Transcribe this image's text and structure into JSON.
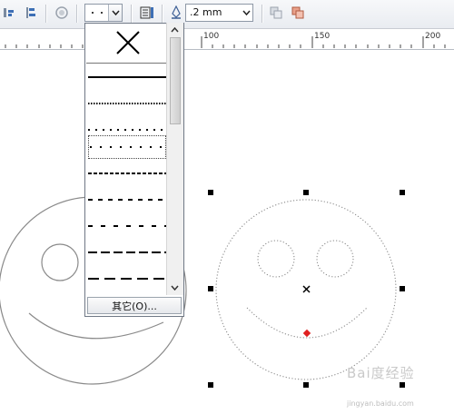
{
  "toolbar": {
    "outline_width_value": ".2 mm",
    "line_style_current": "dotted",
    "icons": [
      "align-icon",
      "distribute-icon",
      "contour-icon",
      "line-style-icon",
      "outline-pen-icon",
      "to-front-icon",
      "to-back-icon"
    ]
  },
  "ruler": {
    "labels": [
      "100",
      "150",
      "200"
    ]
  },
  "dropdown": {
    "options": [
      "none",
      "solid",
      "fine-dotted",
      "dotted",
      "dotted-wide",
      "short-dash",
      "dash",
      "medium-dash",
      "long-dash",
      "extra-long-dash"
    ],
    "selected_index": 3,
    "other_button_label": "其它(O)..."
  },
  "canvas": {
    "selection_marker_color": "#e02020"
  },
  "watermark": {
    "logo_text": "Bai度经验",
    "url": "jingyan.baidu.com"
  }
}
